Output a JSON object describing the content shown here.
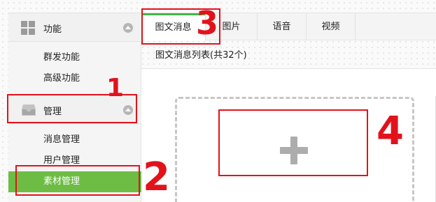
{
  "sidebar": {
    "sections": [
      {
        "label": "功能",
        "icon": "grid-icon",
        "items": [
          "群发功能",
          "高级功能"
        ]
      },
      {
        "label": "管理",
        "icon": "inbox-tray-icon",
        "items": [
          "消息管理",
          "用户管理",
          "素材管理"
        ],
        "active_item": "素材管理"
      }
    ]
  },
  "tabs": [
    {
      "label": "图文消息",
      "active": true
    },
    {
      "label": "图片",
      "active": false
    },
    {
      "label": "语音",
      "active": false
    },
    {
      "label": "视频",
      "active": false
    }
  ],
  "list_title": "图文消息列表(共32个)",
  "add_box": {
    "icon": "plus-icon"
  },
  "annotations": [
    "1",
    "2",
    "3",
    "4"
  ],
  "colors": {
    "active_green": "#6dbd45",
    "tab_accent": "#44b549",
    "annotation_red": "#e2121b"
  }
}
